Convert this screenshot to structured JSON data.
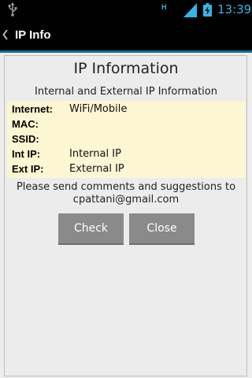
{
  "status_bar": {
    "time": "13:39",
    "network_type_label": "H",
    "icons": [
      "usb-icon",
      "signal-icon",
      "battery-icon"
    ],
    "clock_color": "#33b5e5"
  },
  "action_bar": {
    "title": "IP Info",
    "back_icon": "chevron-left-icon",
    "divider_color": "#0d7194"
  },
  "dialog": {
    "title": "IP Information",
    "subtitle": "Internal and External IP Information",
    "info_background": "#fdf6d3",
    "rows": [
      {
        "label": "Internet:",
        "value": "WiFi/Mobile"
      },
      {
        "label": "MAC:",
        "value": ""
      },
      {
        "label": "SSID:",
        "value": ""
      },
      {
        "label": "Int IP:",
        "value": "Internal IP"
      },
      {
        "label": "Ext IP:",
        "value": "External IP"
      }
    ],
    "comments_line1": "Please send comments and suggestions to",
    "comments_line2": "cpattani@gmail.com",
    "check_label": "Check",
    "close_label": "Close",
    "button_color": "#8a8a8a"
  }
}
